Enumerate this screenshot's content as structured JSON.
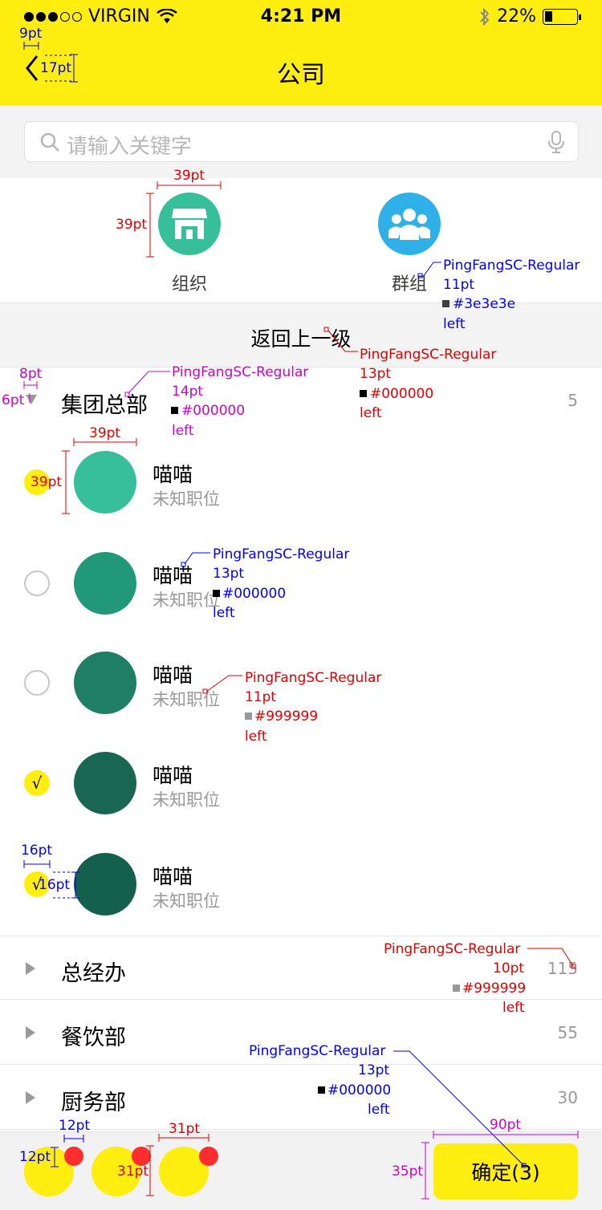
{
  "status_bar": {
    "carrier": "VIRGIN",
    "time": "4:21 PM",
    "battery": "22%",
    "signal_filled": 3,
    "signal_total": 5
  },
  "nav": {
    "title": "公司"
  },
  "search": {
    "placeholder": "请输入关键字"
  },
  "categories": [
    {
      "label": "组织",
      "icon": "store-icon",
      "color": "#36bf9a"
    },
    {
      "label": "群组",
      "icon": "people-icon",
      "color": "#2fb0e8"
    }
  ],
  "back_level": {
    "label": "返回上一级"
  },
  "group_header": {
    "name": "集团总部",
    "count": "5"
  },
  "members": [
    {
      "name": "喵喵",
      "title": "未知职位",
      "checked": true,
      "check_mark": "",
      "avatar_color": "#36bf9a"
    },
    {
      "name": "喵喵",
      "title": "未知职位",
      "checked": false,
      "check_mark": "",
      "avatar_color": "#22987a"
    },
    {
      "name": "喵喵",
      "title": "未知职位",
      "checked": false,
      "check_mark": "",
      "avatar_color": "#1e7f64"
    },
    {
      "name": "喵喵",
      "title": "未知职位",
      "checked": true,
      "check_mark": "√",
      "avatar_color": "#196753"
    },
    {
      "name": "喵喵",
      "title": "未知职位",
      "checked": true,
      "check_mark": "√",
      "avatar_color": "#15604d"
    }
  ],
  "departments": [
    {
      "name": "总经办",
      "count": "115"
    },
    {
      "name": "餐饮部",
      "count": "55"
    },
    {
      "name": "厨务部",
      "count": "30"
    }
  ],
  "bottom": {
    "selected_count": 3,
    "confirm_label": "确定(3)"
  },
  "colors": {
    "brand": "#ffee0f",
    "badge_remove": "#ff2d2d",
    "secondary_text": "#999999",
    "label_text": "#3e3e3e"
  },
  "annotations": [
    {
      "text": "9pt",
      "color": "#0000ff"
    },
    {
      "text": "17pt",
      "color": "#0000ff"
    },
    {
      "text": "39pt",
      "color": "#e00000"
    },
    {
      "text": "39pt",
      "color": "#e00000"
    },
    {
      "text": "PingFangSC-Regular",
      "color": "#0000ff"
    },
    {
      "text": "11pt",
      "color": "#0000ff"
    },
    {
      "text": "#3e3e3e",
      "color": "#0000ff"
    },
    {
      "text": "left",
      "color": "#0000ff"
    },
    {
      "text": "PingFangSC-Regular",
      "color": "#e00000"
    },
    {
      "text": "13pt",
      "color": "#e00000"
    },
    {
      "text": "#000000",
      "color": "#e00000"
    },
    {
      "text": "left",
      "color": "#e00000"
    },
    {
      "text": "8pt",
      "color": "#cc00cc"
    },
    {
      "text": "6pt",
      "color": "#cc00cc"
    },
    {
      "text": "PingFangSC-Regular",
      "color": "#cc00cc"
    },
    {
      "text": "14pt",
      "color": "#cc00cc"
    },
    {
      "text": "#000000",
      "color": "#cc00cc"
    },
    {
      "text": "left",
      "color": "#cc00cc"
    },
    {
      "text": "39pt",
      "color": "#e00000"
    },
    {
      "text": "39pt",
      "color": "#e00000"
    },
    {
      "text": "PingFangSC-Regular",
      "color": "#0000ff"
    },
    {
      "text": "13pt",
      "color": "#0000ff"
    },
    {
      "text": "#000000",
      "color": "#0000ff"
    },
    {
      "text": "left",
      "color": "#0000ff"
    },
    {
      "text": "PingFangSC-Regular",
      "color": "#e00000"
    },
    {
      "text": "11pt",
      "color": "#e00000"
    },
    {
      "text": "#999999",
      "color": "#e00000"
    },
    {
      "text": "left",
      "color": "#e00000"
    },
    {
      "text": "16pt",
      "color": "#0000ff"
    },
    {
      "text": "16pt",
      "color": "#0000ff"
    },
    {
      "text": "PingFangSC-Regular",
      "color": "#e00000"
    },
    {
      "text": "10pt",
      "color": "#e00000"
    },
    {
      "text": "#999999",
      "color": "#e00000"
    },
    {
      "text": "left",
      "color": "#e00000"
    },
    {
      "text": "PingFangSC-Regular",
      "color": "#0000ff"
    },
    {
      "text": "13pt",
      "color": "#0000ff"
    },
    {
      "text": "#000000",
      "color": "#0000ff"
    },
    {
      "text": "left",
      "color": "#0000ff"
    },
    {
      "text": "12pt",
      "color": "#0000ff"
    },
    {
      "text": "12pt",
      "color": "#0000ff"
    },
    {
      "text": "31pt",
      "color": "#e00000"
    },
    {
      "text": "31pt",
      "color": "#e00000"
    },
    {
      "text": "90pt",
      "color": "#cc00cc"
    },
    {
      "text": "35pt",
      "color": "#cc00cc"
    }
  ]
}
